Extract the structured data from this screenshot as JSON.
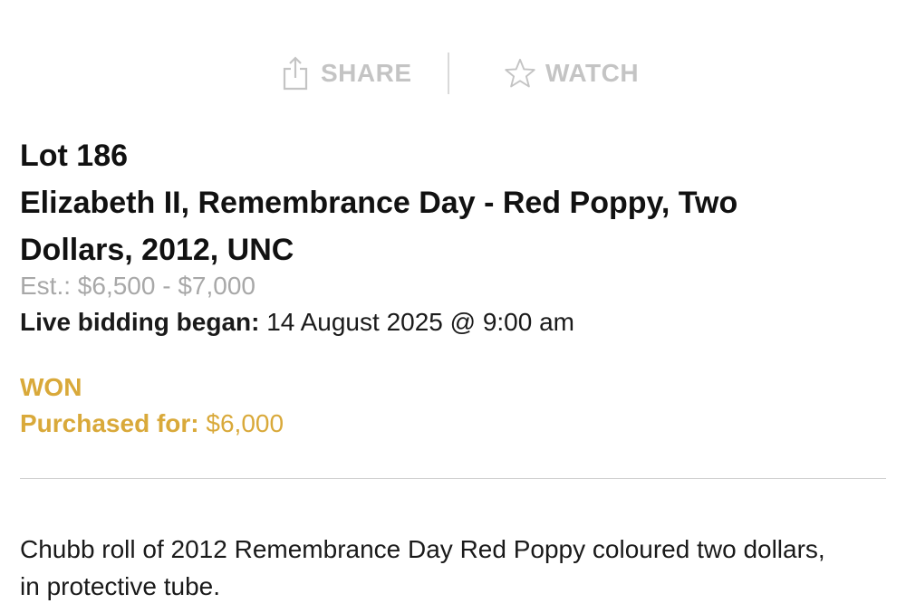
{
  "actions": {
    "share_label": "SHARE",
    "watch_label": "WATCH"
  },
  "lot": {
    "number_label": "Lot 186",
    "title_line1": "Elizabeth II, Remembrance Day - Red Poppy, Two",
    "title_line2": "Dollars, 2012,  UNC",
    "estimate": "Est.: $6,500 - $7,000",
    "bidding_label": "Live bidding began:",
    "bidding_value": " 14 August 2025 @ 9:00 am"
  },
  "result": {
    "status": "WON",
    "purchased_label": "Purchased for:",
    "purchased_value": " $6,000"
  },
  "description": {
    "text": "Chubb roll of 2012 Remembrance Day Red Poppy coloured two dollars, in protective tube."
  },
  "colors": {
    "accent_gold": "#d9a93a",
    "muted_gray": "#c4c4c4",
    "estimate_gray": "#a8a8a8"
  },
  "icons": {
    "share": "share-icon",
    "watch": "star-icon"
  }
}
